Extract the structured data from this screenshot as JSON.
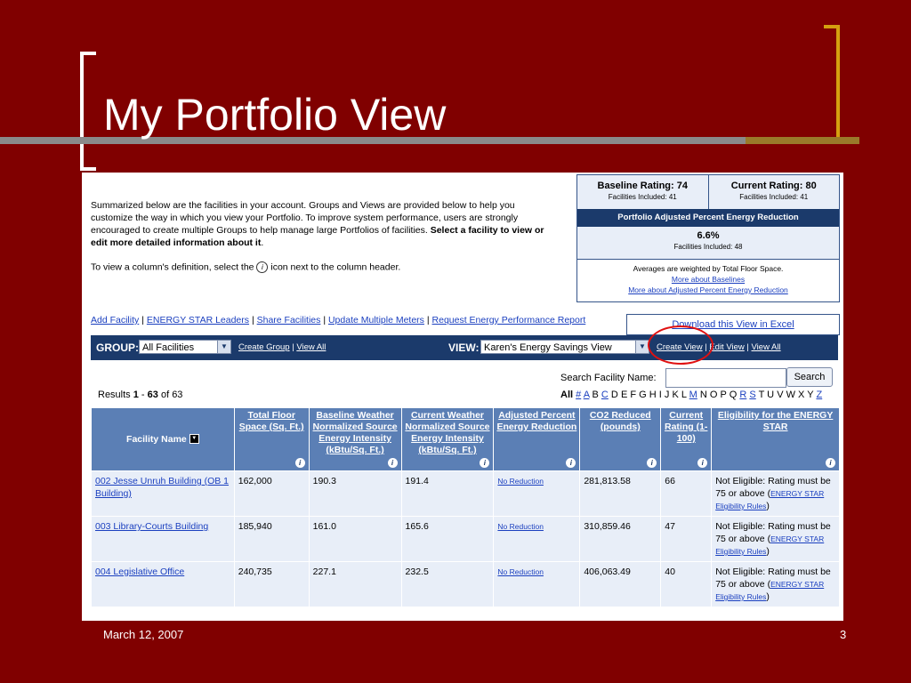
{
  "slide": {
    "title": "My Portfolio View",
    "date": "March 12, 2007",
    "page_number": "3"
  },
  "intro": {
    "text_plain": "Summarized below are the facilities in your account. Groups and Views are provided below to help you customize the way in which you view your Portfolio. To improve system performance, users are strongly encouraged to create multiple Groups to help manage large Portfolios of facilities. ",
    "text_bold": "Select a facility to view or edit more detailed information about it",
    "text_end": ".",
    "column_def_before": "To view a column's definition, select the ",
    "column_def_after": " icon next to the column header."
  },
  "ratings": {
    "baseline": "Baseline Rating: 74",
    "baseline_included": "Facilities Included: 41",
    "current": "Current Rating: 80",
    "current_included": "Facilities Included: 41",
    "band": "Portfolio Adjusted Percent Energy Reduction",
    "percent": "6.6%",
    "percent_included": "Facilities Included: 48",
    "note": "Averages are weighted by Total Floor Space.",
    "link_baselines": "More about Baselines",
    "link_adjusted": "More about Adjusted Percent Energy Reduction"
  },
  "links": {
    "add_facility": "Add Facility",
    "energy_star_leaders": "ENERGY STAR Leaders",
    "share_facilities": "Share Facilities",
    "update_meters": "Update Multiple Meters",
    "request_report": "Request Energy Performance Report",
    "separator": "|",
    "download_excel": "Download this View in Excel"
  },
  "groupbar": {
    "group_label": "GROUP:",
    "group_value": "All Facilities",
    "create_group": "Create Group",
    "view_all_groups": "View All",
    "view_label": "VIEW:",
    "view_value": "Karen's Energy Savings View",
    "create_view": "Create View",
    "edit_view": "Edit View",
    "view_all_views": "View All",
    "separator": "|"
  },
  "search": {
    "label": "Search Facility Name:",
    "value": "",
    "button": "Search",
    "alphabet_all": "All",
    "letters": [
      "#",
      "A",
      "B",
      "C",
      "D",
      "E",
      "F",
      "G",
      "H",
      "I",
      "J",
      "K",
      "L",
      "M",
      "N",
      "O",
      "P",
      "Q",
      "R",
      "S",
      "T",
      "U",
      "V",
      "W",
      "X",
      "Y",
      "Z"
    ],
    "linked_letters": [
      "#",
      "A",
      "C",
      "M",
      "R",
      "S",
      "Z"
    ]
  },
  "results": {
    "prefix": "Results ",
    "from": "1",
    "dash": " - ",
    "to": "63",
    "suffix": " of 63"
  },
  "table": {
    "headers": {
      "facility_name": "Facility Name",
      "floor_space": "Total Floor Space (Sq. Ft.)",
      "baseline_intensity": "Baseline Weather Normalized Source Energy Intensity (kBtu/Sq. Ft.)",
      "current_intensity": "Current Weather Normalized Source Energy Intensity (kBtu/Sq. Ft.)",
      "adjusted_reduction": "Adjusted Percent Energy Reduction",
      "co2": "CO2 Reduced (pounds)",
      "current_rating": "Current Rating (1-100)",
      "eligibility": "Eligibility for the ENERGY STAR"
    },
    "rows": [
      {
        "name": "002 Jesse Unruh Building (OB 1 Building)",
        "floor_space": "162,000",
        "baseline": "190.3",
        "current": "191.4",
        "reduction": "No Reduction",
        "co2": "281,813.58",
        "rating": "66",
        "elig_text": "Not Eligible: Rating must be 75 or above (",
        "elig_link": "ENERGY STAR Eligibility Rules",
        "elig_close": ")"
      },
      {
        "name": "003 Library-Courts Building",
        "floor_space": "185,940",
        "baseline": "161.0",
        "current": "165.6",
        "reduction": "No Reduction",
        "co2": "310,859.46",
        "rating": "47",
        "elig_text": "Not Eligible: Rating must be 75 or above (",
        "elig_link": "ENERGY STAR Eligibility Rules",
        "elig_close": ")"
      },
      {
        "name": "004 Legislative Office",
        "floor_space": "240,735",
        "baseline": "227.1",
        "current": "232.5",
        "reduction": "No Reduction",
        "co2": "406,063.49",
        "rating": "40",
        "elig_text": "Not Eligible: Rating must be 75 or above (",
        "elig_link": "ENERGY STAR Eligibility Rules",
        "elig_close": ")"
      }
    ]
  },
  "colors": {
    "slide_background": "#800000",
    "accent_gold": "#d4a010",
    "nav_bar": "#1b3a6b",
    "header_cell": "#5b7fb5",
    "row_bg": "#e8eef8",
    "highlight_circle": "#e01010"
  }
}
